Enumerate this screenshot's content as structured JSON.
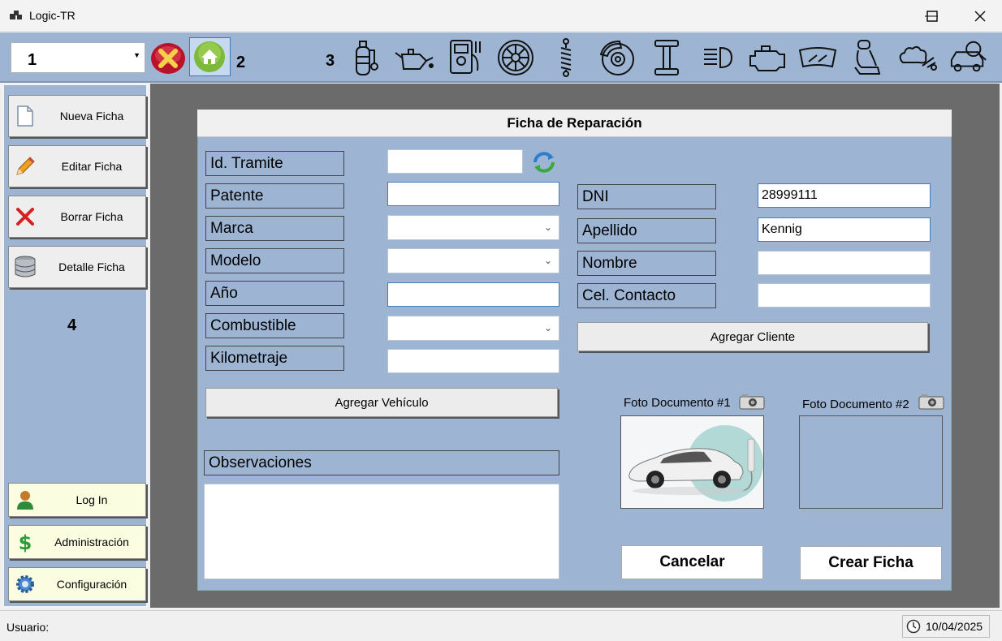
{
  "window": {
    "title": "Logic-TR"
  },
  "toolbar": {
    "combo_value": "1",
    "label_2": "2",
    "label_3": "3",
    "icons": [
      "close-red-icon",
      "home-icon",
      "gas-tank-icon",
      "oil-can-icon",
      "multimeter-icon",
      "tire-icon",
      "shock-absorber-icon",
      "brake-disc-icon",
      "axle-icon",
      "headlight-icon",
      "engine-icon",
      "windshield-icon",
      "car-seat-icon",
      "exhaust-icon",
      "car-inspection-icon"
    ]
  },
  "sidebar": {
    "items": [
      {
        "label": "Nueva Ficha",
        "icon": "document-icon"
      },
      {
        "label": "Editar Ficha",
        "icon": "pencil-icon"
      },
      {
        "label": "Borrar Ficha",
        "icon": "delete-x-icon"
      },
      {
        "label": "Detalle Ficha",
        "icon": "database-icon"
      }
    ],
    "label_4": "4",
    "bottom_items": [
      {
        "label": "Log In",
        "icon": "user-icon"
      },
      {
        "label": "Administración",
        "icon": "dollar-icon"
      },
      {
        "label": "Configuración",
        "icon": "gear-icon"
      }
    ]
  },
  "form": {
    "title": "Ficha de Reparación",
    "vehicle": {
      "id_tramite_label": "Id. Tramite",
      "id_tramite_value": "",
      "patente_label": "Patente",
      "patente_value": "",
      "marca_label": "Marca",
      "marca_value": "",
      "modelo_label": "Modelo",
      "modelo_value": "",
      "anio_label": "Año",
      "anio_value": "",
      "combustible_label": "Combustible",
      "combustible_value": "",
      "kilometraje_label": "Kilometraje",
      "kilometraje_value": "",
      "add_button": "Agregar Vehículo"
    },
    "client": {
      "dni_label": "DNI",
      "dni_value": "28999111",
      "apellido_label": "Apellido",
      "apellido_value": "Kennig",
      "nombre_label": "Nombre",
      "nombre_value": "",
      "cel_label": "Cel. Contacto",
      "cel_value": "",
      "add_button": "Agregar Cliente"
    },
    "observaciones_label": "Observaciones",
    "observaciones_value": "",
    "photo1_label": "Foto Documento #1",
    "photo2_label": "Foto Documento #2",
    "cancel_button": "Cancelar",
    "create_button": "Crear Ficha"
  },
  "statusbar": {
    "user_label": "Usuario:",
    "date": "10/04/2025"
  },
  "colors": {
    "panel": "#9db5d3",
    "main_bg": "#6b6b6b"
  }
}
